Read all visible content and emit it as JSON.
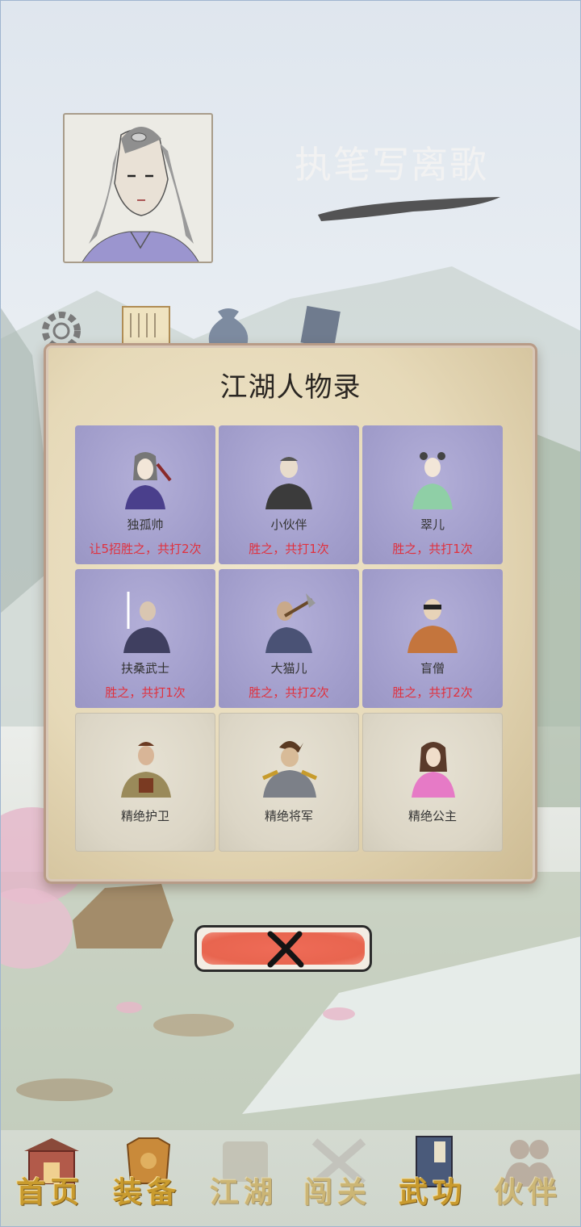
{
  "player": {
    "name": "执笔写离歌"
  },
  "modal": {
    "title": "江湖人物录",
    "characters": [
      {
        "name": "独孤帅",
        "record": "让5招胜之，共打2次",
        "defeated": true
      },
      {
        "name": "小伙伴",
        "record": "胜之，共打1次",
        "defeated": true
      },
      {
        "name": "翠儿",
        "record": "胜之，共打1次",
        "defeated": true
      },
      {
        "name": "扶桑武士",
        "record": "胜之，共打1次",
        "defeated": true
      },
      {
        "name": "大猫儿",
        "record": "胜之，共打2次",
        "defeated": true
      },
      {
        "name": "盲僧",
        "record": "胜之，共打2次",
        "defeated": true
      },
      {
        "name": "精绝护卫",
        "record": "",
        "defeated": false
      },
      {
        "name": "精绝将军",
        "record": "",
        "defeated": false
      },
      {
        "name": "精绝公主",
        "record": "",
        "defeated": false
      }
    ],
    "close_icon": "close-x-icon"
  },
  "nav": {
    "items": [
      {
        "label": "首页",
        "icon": "house-icon"
      },
      {
        "label": "装备",
        "icon": "armor-icon"
      },
      {
        "label": "江湖",
        "icon": "scroll-map-icon"
      },
      {
        "label": "闯关",
        "icon": "crossed-swords-icon"
      },
      {
        "label": "武功",
        "icon": "martial-book-icon"
      },
      {
        "label": "伙伴",
        "icon": "companions-icon"
      }
    ]
  },
  "colors": {
    "known_cell": "#a19dcb",
    "unknown_cell": "#dcd6c6",
    "record_text": "#e0313e",
    "nav_gold": "#c99b2e",
    "close_red": "#e8654f"
  }
}
